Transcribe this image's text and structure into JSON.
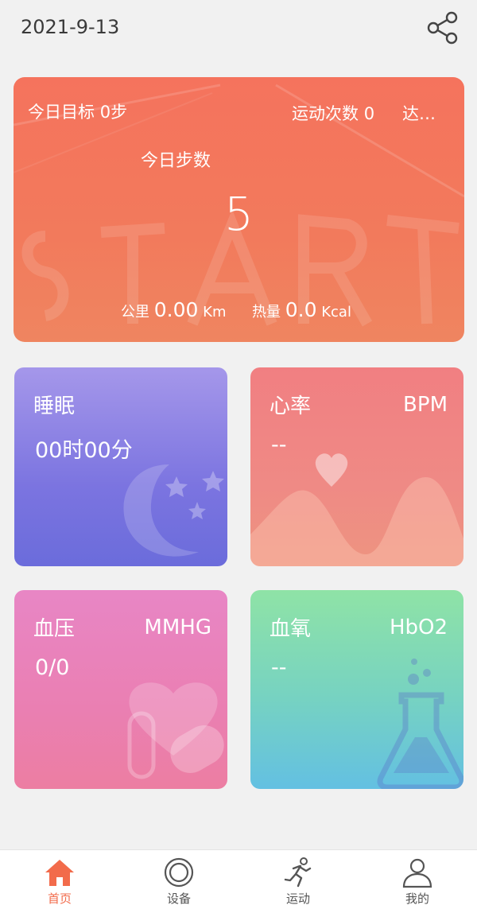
{
  "header": {
    "date": "2021-9-13",
    "share_icon": "share-icon"
  },
  "steps_card": {
    "goal_label": "今日目标",
    "goal_value": "0",
    "goal_unit": "步",
    "sport_count_label": "运动次数",
    "sport_count_value": "0",
    "reach_label": "达标率",
    "today_steps_label": "今日步数",
    "today_steps_value": "5",
    "distance_label": "公里",
    "distance_value": "0.00",
    "distance_unit": "Km",
    "calorie_label": "热量",
    "calorie_value": "0.0",
    "calorie_unit": "Kcal"
  },
  "tiles": {
    "sleep": {
      "title": "睡眠",
      "value": "00时00分",
      "icon": "moon-stars-icon"
    },
    "heart_rate": {
      "title": "心率",
      "unit": "BPM",
      "value": "--",
      "icon": "heart-wave-icon"
    },
    "blood_pressure": {
      "title": "血压",
      "unit": "MMHG",
      "value": "0/0",
      "icon": "heart-pill-icon"
    },
    "blood_oxygen": {
      "title": "血氧",
      "unit": "HbO2",
      "value": "--",
      "icon": "flask-icon"
    }
  },
  "tabbar": {
    "items": [
      {
        "label": "首页",
        "icon": "home-icon",
        "active": true
      },
      {
        "label": "设备",
        "icon": "watch-icon",
        "active": false
      },
      {
        "label": "运动",
        "icon": "runner-icon",
        "active": false
      },
      {
        "label": "我的",
        "icon": "user-icon",
        "active": false
      }
    ]
  },
  "colors": {
    "accent": "#f26b4b",
    "tab_inactive": "#555555"
  }
}
